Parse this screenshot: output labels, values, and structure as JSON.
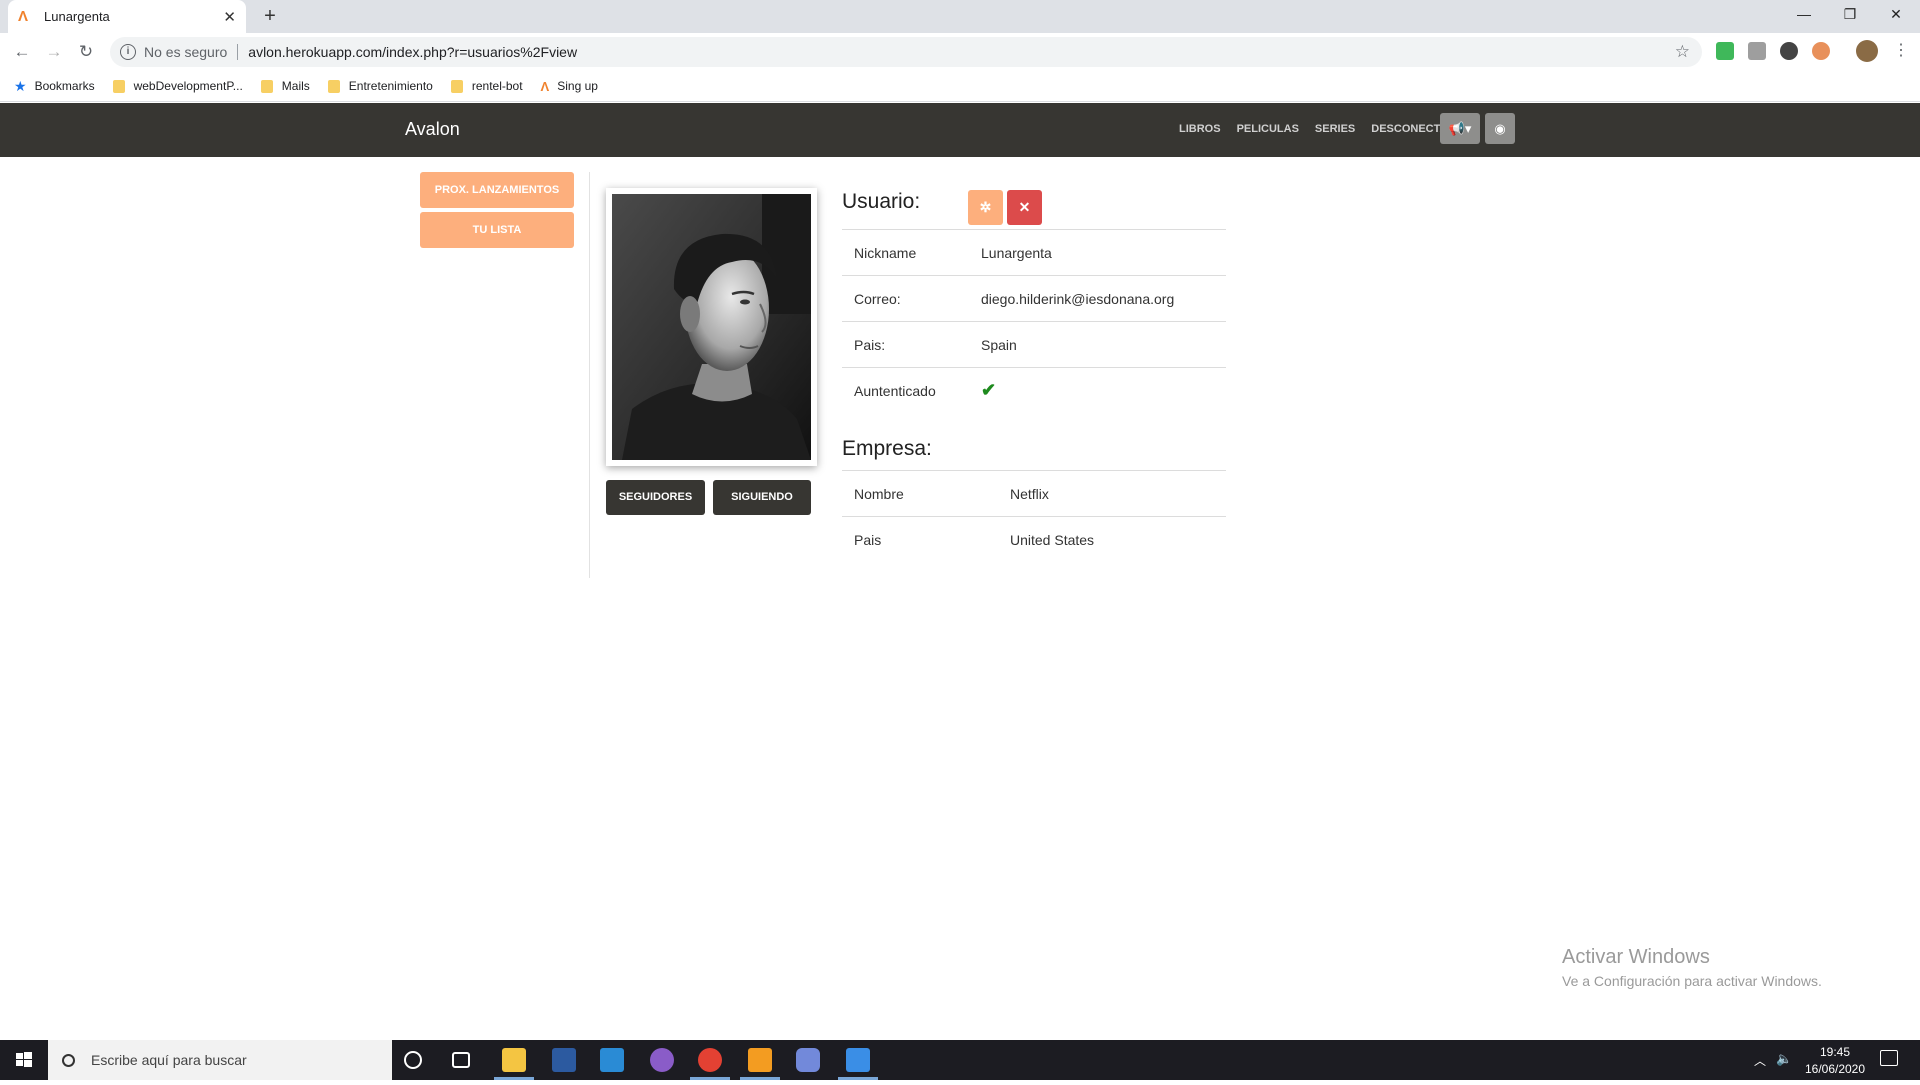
{
  "browser": {
    "tab_title": "Lunargenta",
    "tab_close": "✕",
    "new_tab": "+",
    "security_label": "No es seguro",
    "url": "avlon.herokuapp.com/index.php?r=usuarios%2Fview",
    "bookmarks": [
      {
        "label": "Bookmarks"
      },
      {
        "label": "webDevelopmentP..."
      },
      {
        "label": "Mails"
      },
      {
        "label": "Entretenimiento"
      },
      {
        "label": "rentel-bot"
      },
      {
        "label": "Sing up"
      }
    ]
  },
  "navbar": {
    "brand": "Avalon",
    "links": [
      "LIBROS",
      "PELICULAS",
      "SERIES",
      "DESCONECTAR"
    ],
    "announce_icon": "megaphone-icon",
    "eye_icon": "eye-icon"
  },
  "sidebar": {
    "buttons": [
      "PROX. LANZAMIENTOS",
      "TU LISTA"
    ]
  },
  "profile": {
    "followers_label": "SEGUIDORES",
    "following_label": "SIGUIENDO"
  },
  "user": {
    "heading": "Usuario:",
    "rows": [
      {
        "key": "Nickname",
        "value": "Lunargenta"
      },
      {
        "key": "Correo:",
        "value": "diego.hilderink@iesdonana.org"
      },
      {
        "key": "Pais:",
        "value": "Spain"
      },
      {
        "key": "Auntenticado",
        "value": "✔"
      }
    ]
  },
  "company": {
    "heading": "Empresa:",
    "rows": [
      {
        "key": "Nombre",
        "value": "Netflix"
      },
      {
        "key": "Pais",
        "value": "United States"
      }
    ]
  },
  "watermark": {
    "line1": "Activar Windows",
    "line2": "Ve a Configuración para activar Windows."
  },
  "taskbar": {
    "search_placeholder": "Escribe aquí para buscar",
    "time": "19:45",
    "date": "16/06/2020"
  },
  "colors": {
    "navbar_bg": "#373632",
    "accent_orange": "#fdaf7d",
    "delete_red": "#dc4b4b"
  }
}
